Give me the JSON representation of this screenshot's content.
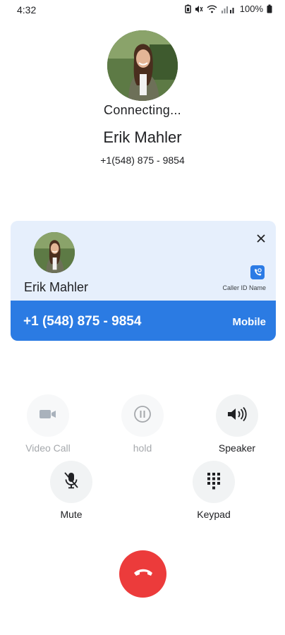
{
  "status_bar": {
    "time": "4:32",
    "battery": "100%"
  },
  "call": {
    "status": "Connecting...",
    "name": "Erik Mahler",
    "number": "+1(548) 875 - 9854"
  },
  "caller_id_card": {
    "name": "Erik Mahler",
    "app_label": "Caller ID Name",
    "number": "+1 (548) 875 - 9854",
    "number_type": "Mobile",
    "accent_color": "#2b7be3"
  },
  "controls": {
    "video_call": "Video Call",
    "hold": "hold",
    "speaker": "Speaker",
    "mute": "Mute",
    "keypad": "Keypad"
  },
  "colors": {
    "end_call": "#ec3b3b",
    "card_background": "#e6effc"
  },
  "icons": [
    "battery-saver-icon",
    "mute-notification-icon",
    "wifi-icon",
    "signal-icon",
    "battery-icon",
    "close-icon",
    "caller-id-app-icon",
    "video-camera-icon",
    "pause-icon",
    "speaker-icon",
    "mic-off-icon",
    "dialpad-icon",
    "end-call-icon"
  ]
}
